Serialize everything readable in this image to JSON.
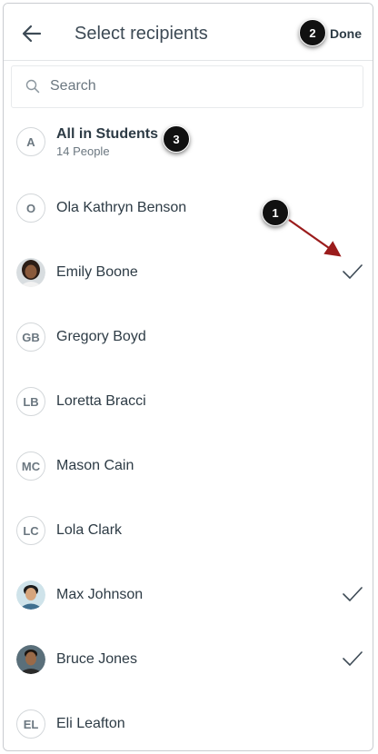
{
  "header": {
    "title": "Select recipients",
    "done_label": "Done"
  },
  "search": {
    "placeholder": "Search",
    "value": ""
  },
  "recipients": [
    {
      "type": "group",
      "initials": "A",
      "name": "All in Students",
      "subtitle": "14 People",
      "selected": false
    },
    {
      "type": "person",
      "initials": "O",
      "name": "Ola Kathryn Benson",
      "selected": false
    },
    {
      "type": "person",
      "initials": "",
      "avatar": "photo-avatar-emily",
      "name": "Emily Boone",
      "selected": true
    },
    {
      "type": "person",
      "initials": "GB",
      "name": "Gregory Boyd",
      "selected": false
    },
    {
      "type": "person",
      "initials": "LB",
      "name": "Loretta Bracci",
      "selected": false
    },
    {
      "type": "person",
      "initials": "MC",
      "name": "Mason Cain",
      "selected": false
    },
    {
      "type": "person",
      "initials": "LC",
      "name": "Lola Clark",
      "selected": false
    },
    {
      "type": "person",
      "initials": "",
      "avatar": "photo-avatar-max",
      "name": "Max Johnson",
      "selected": true
    },
    {
      "type": "person",
      "initials": "",
      "avatar": "photo-avatar-bruce",
      "name": "Bruce Jones",
      "selected": true
    },
    {
      "type": "person",
      "initials": "EL",
      "name": "Eli Leafton",
      "selected": false
    }
  ],
  "annotations": {
    "badge_1": "1",
    "badge_2": "2",
    "badge_3": "3"
  },
  "colors": {
    "text": "#2d3b45",
    "muted": "#6b7780",
    "arrow": "#9b1c1c",
    "badge": "#111111"
  },
  "icons": {
    "back": "arrow-left-icon",
    "search": "magnifier-icon",
    "check": "checkmark-icon"
  }
}
